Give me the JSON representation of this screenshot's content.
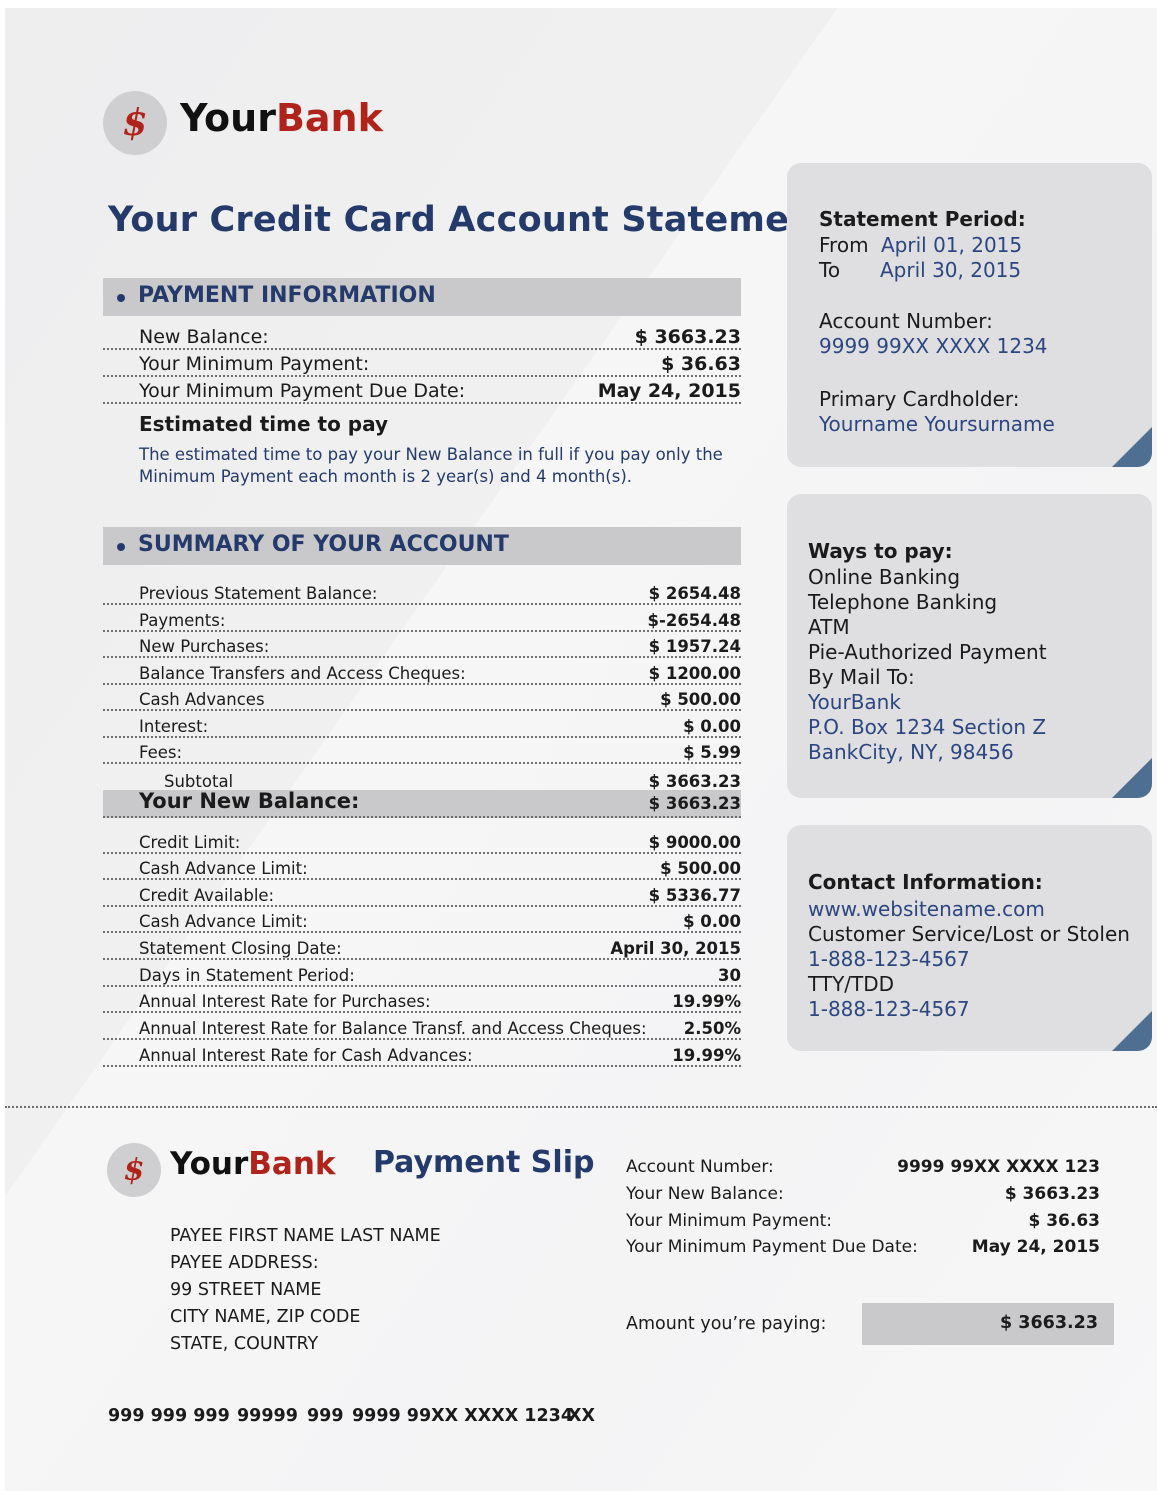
{
  "brand": {
    "part1": "Your",
    "part2": "Bank",
    "symbol": "$"
  },
  "title": "Your Credit Card Account Statement",
  "payment_info": {
    "heading": "PAYMENT INFORMATION",
    "rows": [
      {
        "label": "New Balance:",
        "value": "$ 3663.23"
      },
      {
        "label": "Your Minimum Payment:",
        "value": "$ 36.63"
      },
      {
        "label": "Your Minimum Payment Due Date:",
        "value": "May 24, 2015"
      }
    ],
    "estimate_heading": "Estimated time to pay",
    "estimate_text": "The estimated time to pay your New Balance in full if you pay only the Minimum Payment each month is 2 year(s) and 4 month(s)."
  },
  "summary": {
    "heading": "SUMMARY OF YOUR ACCOUNT",
    "rows": [
      {
        "label": "Previous Statement Balance:",
        "value": "$ 2654.48"
      },
      {
        "label": "Payments:",
        "value": "$-2654.48"
      },
      {
        "label": "New Purchases:",
        "value": "$ 1957.24"
      },
      {
        "label": "Balance Transfers and Access Cheques:",
        "value": "$ 1200.00"
      },
      {
        "label": "Cash Advances",
        "value": "$ 500.00"
      },
      {
        "label": "Interest:",
        "value": "$ 0.00"
      },
      {
        "label": "Fees:",
        "value": "$ 5.99"
      },
      {
        "label": "Subtotal",
        "value": "$ 3663.23"
      }
    ],
    "new_balance": {
      "label": "Your New Balance:",
      "value": "$ 3663.23"
    },
    "rows2": [
      {
        "label": "Credit Limit:",
        "value": "$ 9000.00"
      },
      {
        "label": "Cash Advance Limit:",
        "value": "$ 500.00"
      },
      {
        "label": "Credit Available:",
        "value": "$ 5336.77"
      },
      {
        "label": "Cash Advance Limit:",
        "value": "$ 0.00"
      },
      {
        "label": "Statement Closing Date:",
        "value": "April 30, 2015"
      },
      {
        "label": "Days in Statement Period:",
        "value": "30"
      },
      {
        "label": "Annual Interest Rate for Purchases:",
        "value": "19.99%"
      },
      {
        "label": "Annual Interest Rate for Balance Transf. and Access Cheques:",
        "value": "2.50%"
      },
      {
        "label": "Annual Interest Rate for Cash Advances:",
        "value": "19.99%"
      }
    ]
  },
  "period_panel": {
    "heading": "Statement Period:",
    "from_label": "From",
    "from_value": "April 01, 2015",
    "to_label": "To",
    "to_value": "April 30, 2015",
    "account_label": "Account Number:",
    "account_value": "9999 99XX XXXX 1234",
    "holder_label": "Primary Cardholder:",
    "holder_value": "Yourname Yoursurname"
  },
  "ways_panel": {
    "heading": "Ways to pay:",
    "items": [
      "Online Banking",
      "Telephone Banking",
      "ATM",
      "Pie-Authorized Payment",
      "By Mail To:"
    ],
    "address": [
      "YourBank",
      "P.O. Box 1234 Section Z",
      "BankCity, NY, 98456"
    ]
  },
  "contact_panel": {
    "heading": "Contact Information:",
    "website": "www.websitename.com",
    "service_label": "Customer Service/Lost or Stolen",
    "service_phone": "1-888-123-4567",
    "tty_label": "TTY/TDD",
    "tty_phone": "1-888-123-4567"
  },
  "slip": {
    "title": "Payment Slip",
    "payee": [
      "PAYEE FIRST NAME LAST NAME",
      "PAYEE ADDRESS:",
      "99 STREET NAME",
      "CITY NAME, ZIP CODE",
      "STATE, COUNTRY"
    ],
    "rows": [
      {
        "label": "Account Number:",
        "value": "9999 99XX XXXX 123"
      },
      {
        "label": "Your New Balance:",
        "value": "$ 3663.23"
      },
      {
        "label": "Your Minimum Payment:",
        "value": "$ 36.63"
      },
      {
        "label": "Your Minimum Payment Due Date:",
        "value": "May 24, 2015"
      }
    ],
    "amount_label": "Amount you’re paying:",
    "amount_value": "$ 3663.23",
    "micr": [
      "999 999 999",
      "99999",
      "999",
      "9999 99XX XXXX 1234",
      "XX"
    ]
  }
}
